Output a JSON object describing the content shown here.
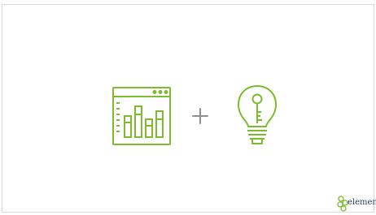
{
  "illustration": {
    "left_icon": "dashboard-bar-chart-icon",
    "operator_icon": "plus-icon",
    "right_icon": "lightbulb-key-icon",
    "accent_color": "#7dbb2f",
    "operator_color": "#8f8f8f"
  },
  "brand": {
    "logo_icon": "hexagon-cluster-logo-icon",
    "name": "element",
    "text_color": "#2c3e66",
    "logo_color": "#7dbb2f"
  }
}
